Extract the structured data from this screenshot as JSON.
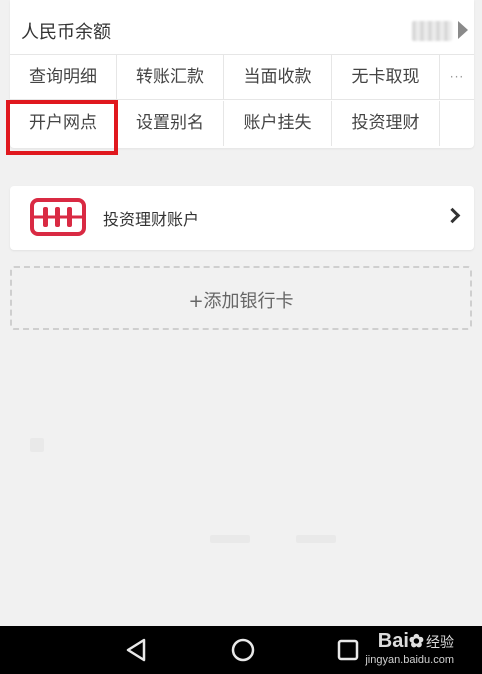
{
  "balance": {
    "label": "人民币余额"
  },
  "actions": [
    {
      "label": "查询明细"
    },
    {
      "label": "转账汇款"
    },
    {
      "label": "当面收款"
    },
    {
      "label": "无卡取现"
    },
    {
      "label": "···"
    },
    {
      "label": "开户网点"
    },
    {
      "label": "设置别名"
    },
    {
      "label": "账户挂失"
    },
    {
      "label": "投资理财"
    },
    {
      "label": ""
    }
  ],
  "invest_account": {
    "label": "投资理财账户",
    "icon": "abacus-icon"
  },
  "add_card": {
    "label": "+添加银行卡"
  },
  "watermark": {
    "brand": "Bai",
    "brand_cn": "经验",
    "url": "jingyan.baidu.com"
  },
  "colors": {
    "highlight": "#e0181e",
    "icon_red": "#d92a43"
  }
}
